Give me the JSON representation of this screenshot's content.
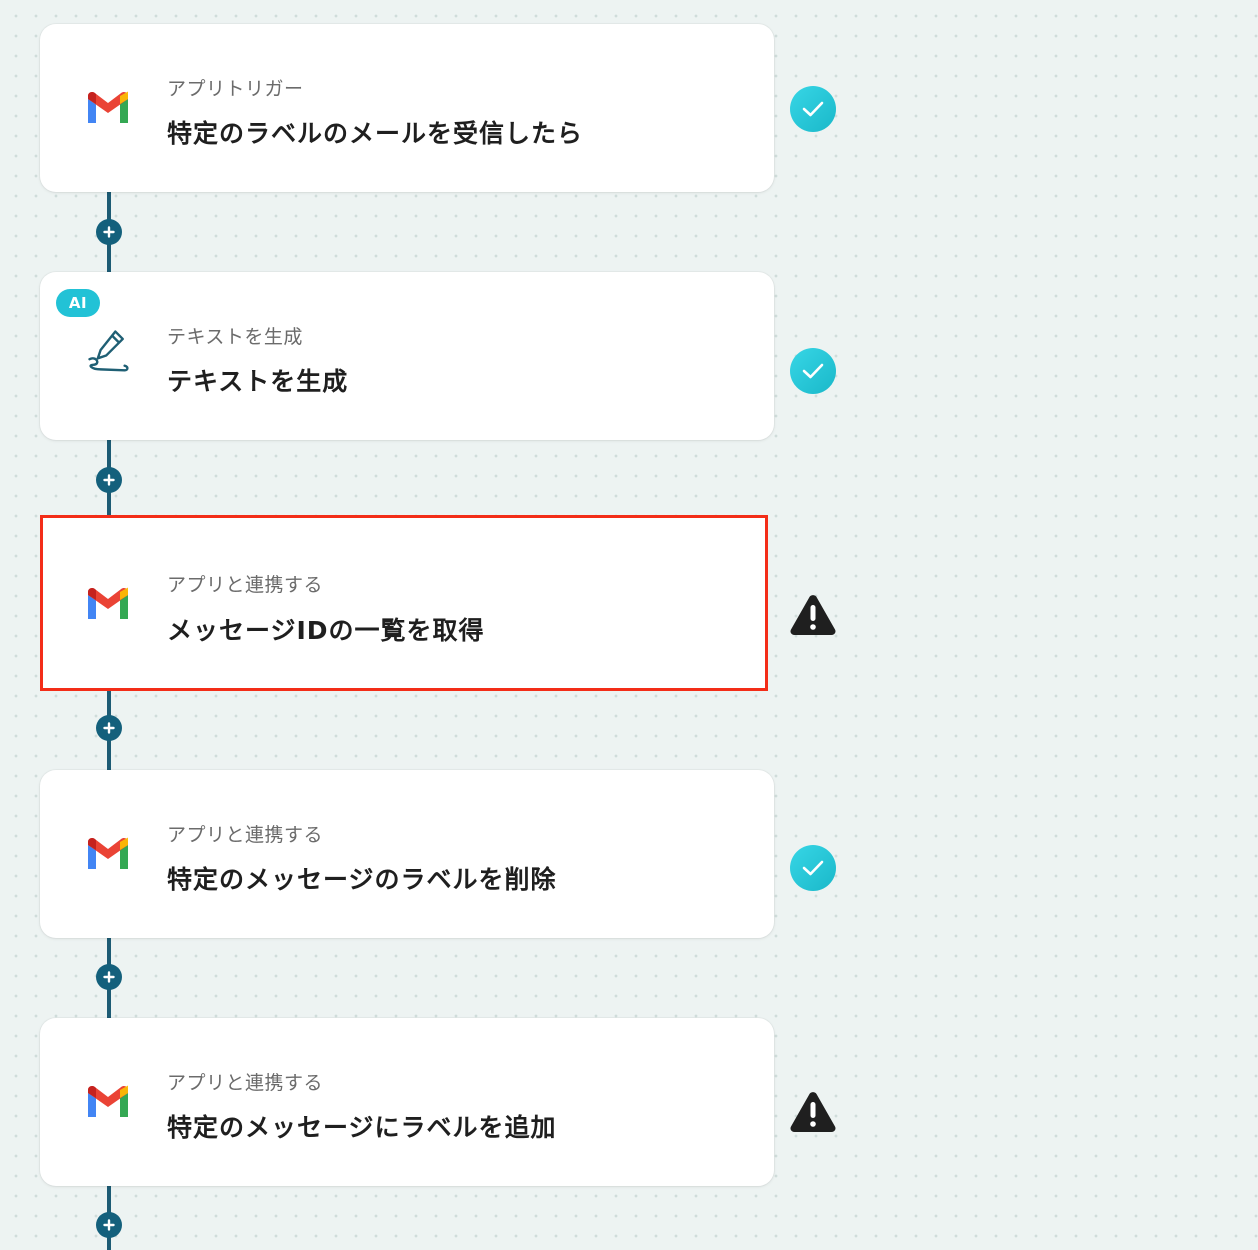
{
  "workflow": {
    "steps": [
      {
        "subtitle": "アプリトリガー",
        "title": "特定のラベルのメールを受信したら",
        "icon": "gmail-icon",
        "status": "ok",
        "ai_badge": ""
      },
      {
        "subtitle": "テキストを生成",
        "title": "テキストを生成",
        "icon": "pen-icon",
        "status": "ok",
        "ai_badge": "AI"
      },
      {
        "subtitle": "アプリと連携する",
        "title": "メッセージIDの一覧を取得",
        "icon": "gmail-icon",
        "status": "warning",
        "ai_badge": "",
        "selected": true
      },
      {
        "subtitle": "アプリと連携する",
        "title": "特定のメッセージのラベルを削除",
        "icon": "gmail-icon",
        "status": "ok",
        "ai_badge": ""
      },
      {
        "subtitle": "アプリと連携する",
        "title": "特定のメッセージにラベルを追加",
        "icon": "gmail-icon",
        "status": "warning",
        "ai_badge": ""
      }
    ]
  },
  "colors": {
    "background": "#edf3f2",
    "connector": "#1d5b74",
    "plus_button": "#14607c",
    "status_ok": "#22c2d6",
    "status_warning": "#1f1f1f",
    "selection_border": "#f32d18",
    "ai_badge": "#22c2d6"
  }
}
